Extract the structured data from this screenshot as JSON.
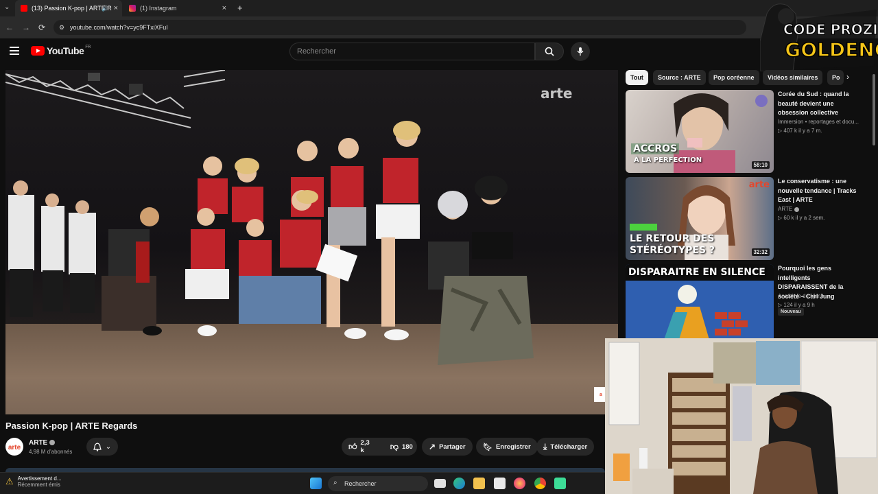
{
  "browser": {
    "tabs": [
      {
        "title": "(13) Passion K-pop | ARTE R",
        "active": true
      },
      {
        "title": "(1) Instagram",
        "active": false
      }
    ],
    "url": "youtube.com/watch?v=yc9FTxiXFuI"
  },
  "youtube": {
    "logo_text": "YouTube",
    "region": "FR",
    "search_placeholder": "Rechercher"
  },
  "video": {
    "watermark": "arte",
    "title": "Passion K-pop | ARTE Regards",
    "channel": "ARTE",
    "subscribers": "4,98 M d'abonnés",
    "likes": "2,3 k",
    "dislikes": "180",
    "share_label": "Partager",
    "save_label": "Enregistrer",
    "download_label": "Télécharger"
  },
  "chips": [
    "Tout",
    "Source : ARTE",
    "Pop coréenne",
    "Vidéos similaires",
    "Po"
  ],
  "recommendations": [
    {
      "title": "Corée du Sud : quand la beauté devient une obsession collective",
      "channel": "Immersion • reportages et docu...",
      "meta": "▷ 407 k   il y a 7 m.",
      "duration": "58:10",
      "thumb_text_1": "ACCROS",
      "thumb_text_2": "À LA PERFECTION"
    },
    {
      "title": "Le conservatisme : une nouvelle tendance | Tracks East | ARTE",
      "channel": "ARTE",
      "meta": "▷ 60 k   il y a 2 sem.",
      "duration": "32:32",
      "thumb_text_1": "LE RETOUR DES",
      "thumb_text_2": "STÉRÉOTYPES ?",
      "thumb_logo": "arte"
    },
    {
      "title": "Pourquoi les gens intelligents DISPARAISSENT de la société – Carl Jung",
      "channel": "Anatomie de l'Ame",
      "meta": "▷ 124   il y a 9 h",
      "badge": "Nouveau",
      "thumb_text_1": "DISPARAITRE EN SILENCE"
    }
  ],
  "overlay": {
    "brand_line1": "CODE PROZIS",
    "brand_line2": "GOLDENG"
  },
  "taskbar": {
    "notification_title": "Avertissement d...",
    "notification_sub": "Récemment émis",
    "search_label": "Rechercher"
  }
}
